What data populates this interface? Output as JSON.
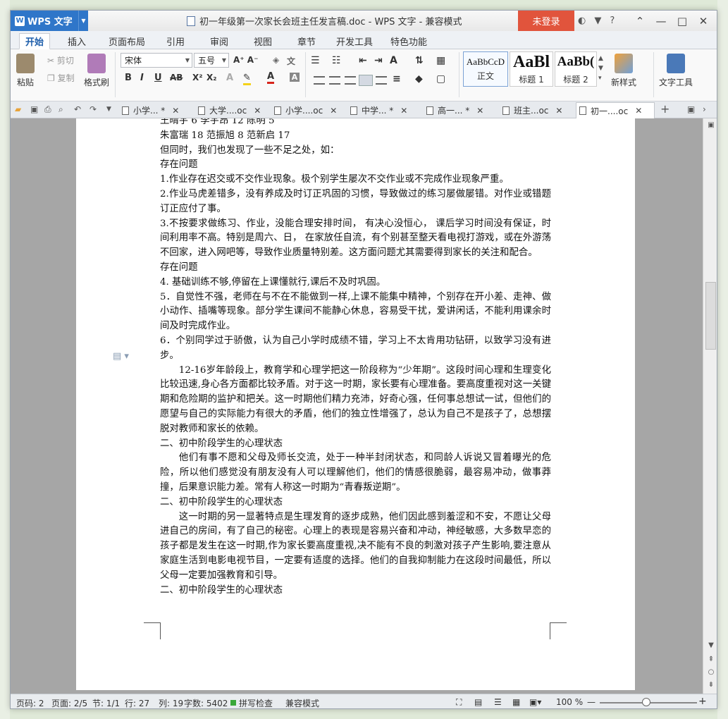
{
  "app": {
    "name": "WPS 文字",
    "logo": "W",
    "doc_title": "初一年级第一次家长会班主任发言稿.doc - WPS 文字 - 兼容模式",
    "login": "未登录"
  },
  "ribbon_tabs": [
    "开始",
    "插入",
    "页面布局",
    "引用",
    "审阅",
    "视图",
    "章节",
    "开发工具",
    "特色功能"
  ],
  "clipboard": {
    "paste": "粘贴",
    "cut": "剪切",
    "copy": "复制",
    "format_painter": "格式刷"
  },
  "font": {
    "family": "宋体",
    "size": "五号"
  },
  "styles": [
    {
      "preview": "AaBbCcD",
      "name": "正文"
    },
    {
      "preview": "AaBl",
      "name": "标题 1"
    },
    {
      "preview": "AaBb(",
      "name": "标题 2"
    }
  ],
  "ribbon_right": {
    "new_style": "新样式",
    "text_tools": "文字工具"
  },
  "doc_tabs": [
    "小学... *",
    "大学....oc",
    "小学....oc",
    "中学... *",
    "高一... *",
    "班主...oc",
    "初一....oc"
  ],
  "document": {
    "lines": [
      "王晴宇 6      李宇昂 12    陈明 5",
      "朱富瑞 18   范振旭  8   范新启 17",
      "但同时，我们也发现了一些不足之处，如：",
      "存在问题",
      "1.作业存在迟交或不交作业现象。极个别学生屡次不交作业或不完成作业现象严重。",
      "2.作业马虎差错多，没有养成及时订正巩固的习惯，导致做过的练习屡做屡错。对作业或错题订正应付了事。",
      "3.不按要求做练习、作业，没能合理安排时间， 有决心没恒心， 课后学习时间没有保证，时间利用率不高。特别是周六、日， 在家放任自流，有个别甚至整天看电视打游戏，或在外游荡不回家，进入网吧等，导致作业质量特别差。这方面问题尤其需要得到家长的关注和配合。",
      "存在问题",
      "4. 基础训练不够,停留在上课懂就行,课后不及时巩固。",
      "5．自觉性不强，老师在与不在不能做到一样,上课不能集中精神，个别存在开小差、走神、做小动作、插嘴等现象。部分学生课间不能静心休息，容易受干扰，爱讲闲话，不能利用课余时间及时完成作业。",
      "6．个别同学过于骄傲，认为自己小学时成绩不错，学习上不太肯用功钻研，以致学习没有进步。",
      "12-16岁年龄段上，教育学和心理学把这一阶段称为“少年期”。这段时间心理和生理变化比较迅速,身心各方面都比较矛盾。对于这一时期，家长要有心理准备。要高度重视对这一关键期和危险期的监护和把关。这一时期他们精力充沛，好奇心强，任何事总想试一试，但他们的愿望与自己的实际能力有很大的矛盾，他们的独立性增强了，总认为自己不是孩子了，总想摆脱对教师和家长的依赖。",
      "二、初中阶段学生的心理状态",
      "他们有事不愿和父母及师长交流，处于一种半封闭状态，和同龄人诉说又冒着曝光的危险，所以他们感觉没有朋友没有人可以理解他们，他们的情感很脆弱，最容易冲动，做事莽撞，后果意识能力差。常有人称这一时期为“青春叛逆期”。",
      "二、初中阶段学生的心理状态",
      "这一时期的另一显著特点是生理发育的逐步成熟，他们因此感到羞涩和不安，不愿让父母进自己的房间，有了自己的秘密。心理上的表现是容易兴奋和冲动，神经敏感，大多数早恋的孩子都是发生在这一时期,作为家长要高度重视,决不能有不良的刺激对孩子产生影响,要注意从家庭生活到电影电视节目，一定要有适度的选择。他们的自我抑制能力在这段时间最低，所以父母一定要加强教育和引导。",
      "二、初中阶段学生的心理状态"
    ]
  },
  "status": {
    "page_num": "页码: 2",
    "pages": "页面: 2/5",
    "section": "节: 1/1",
    "row": "行: 27",
    "col": "列: 19",
    "words": "字数: 5402",
    "spell": "拼写检查",
    "mode": "兼容模式",
    "zoom": "100 %"
  }
}
